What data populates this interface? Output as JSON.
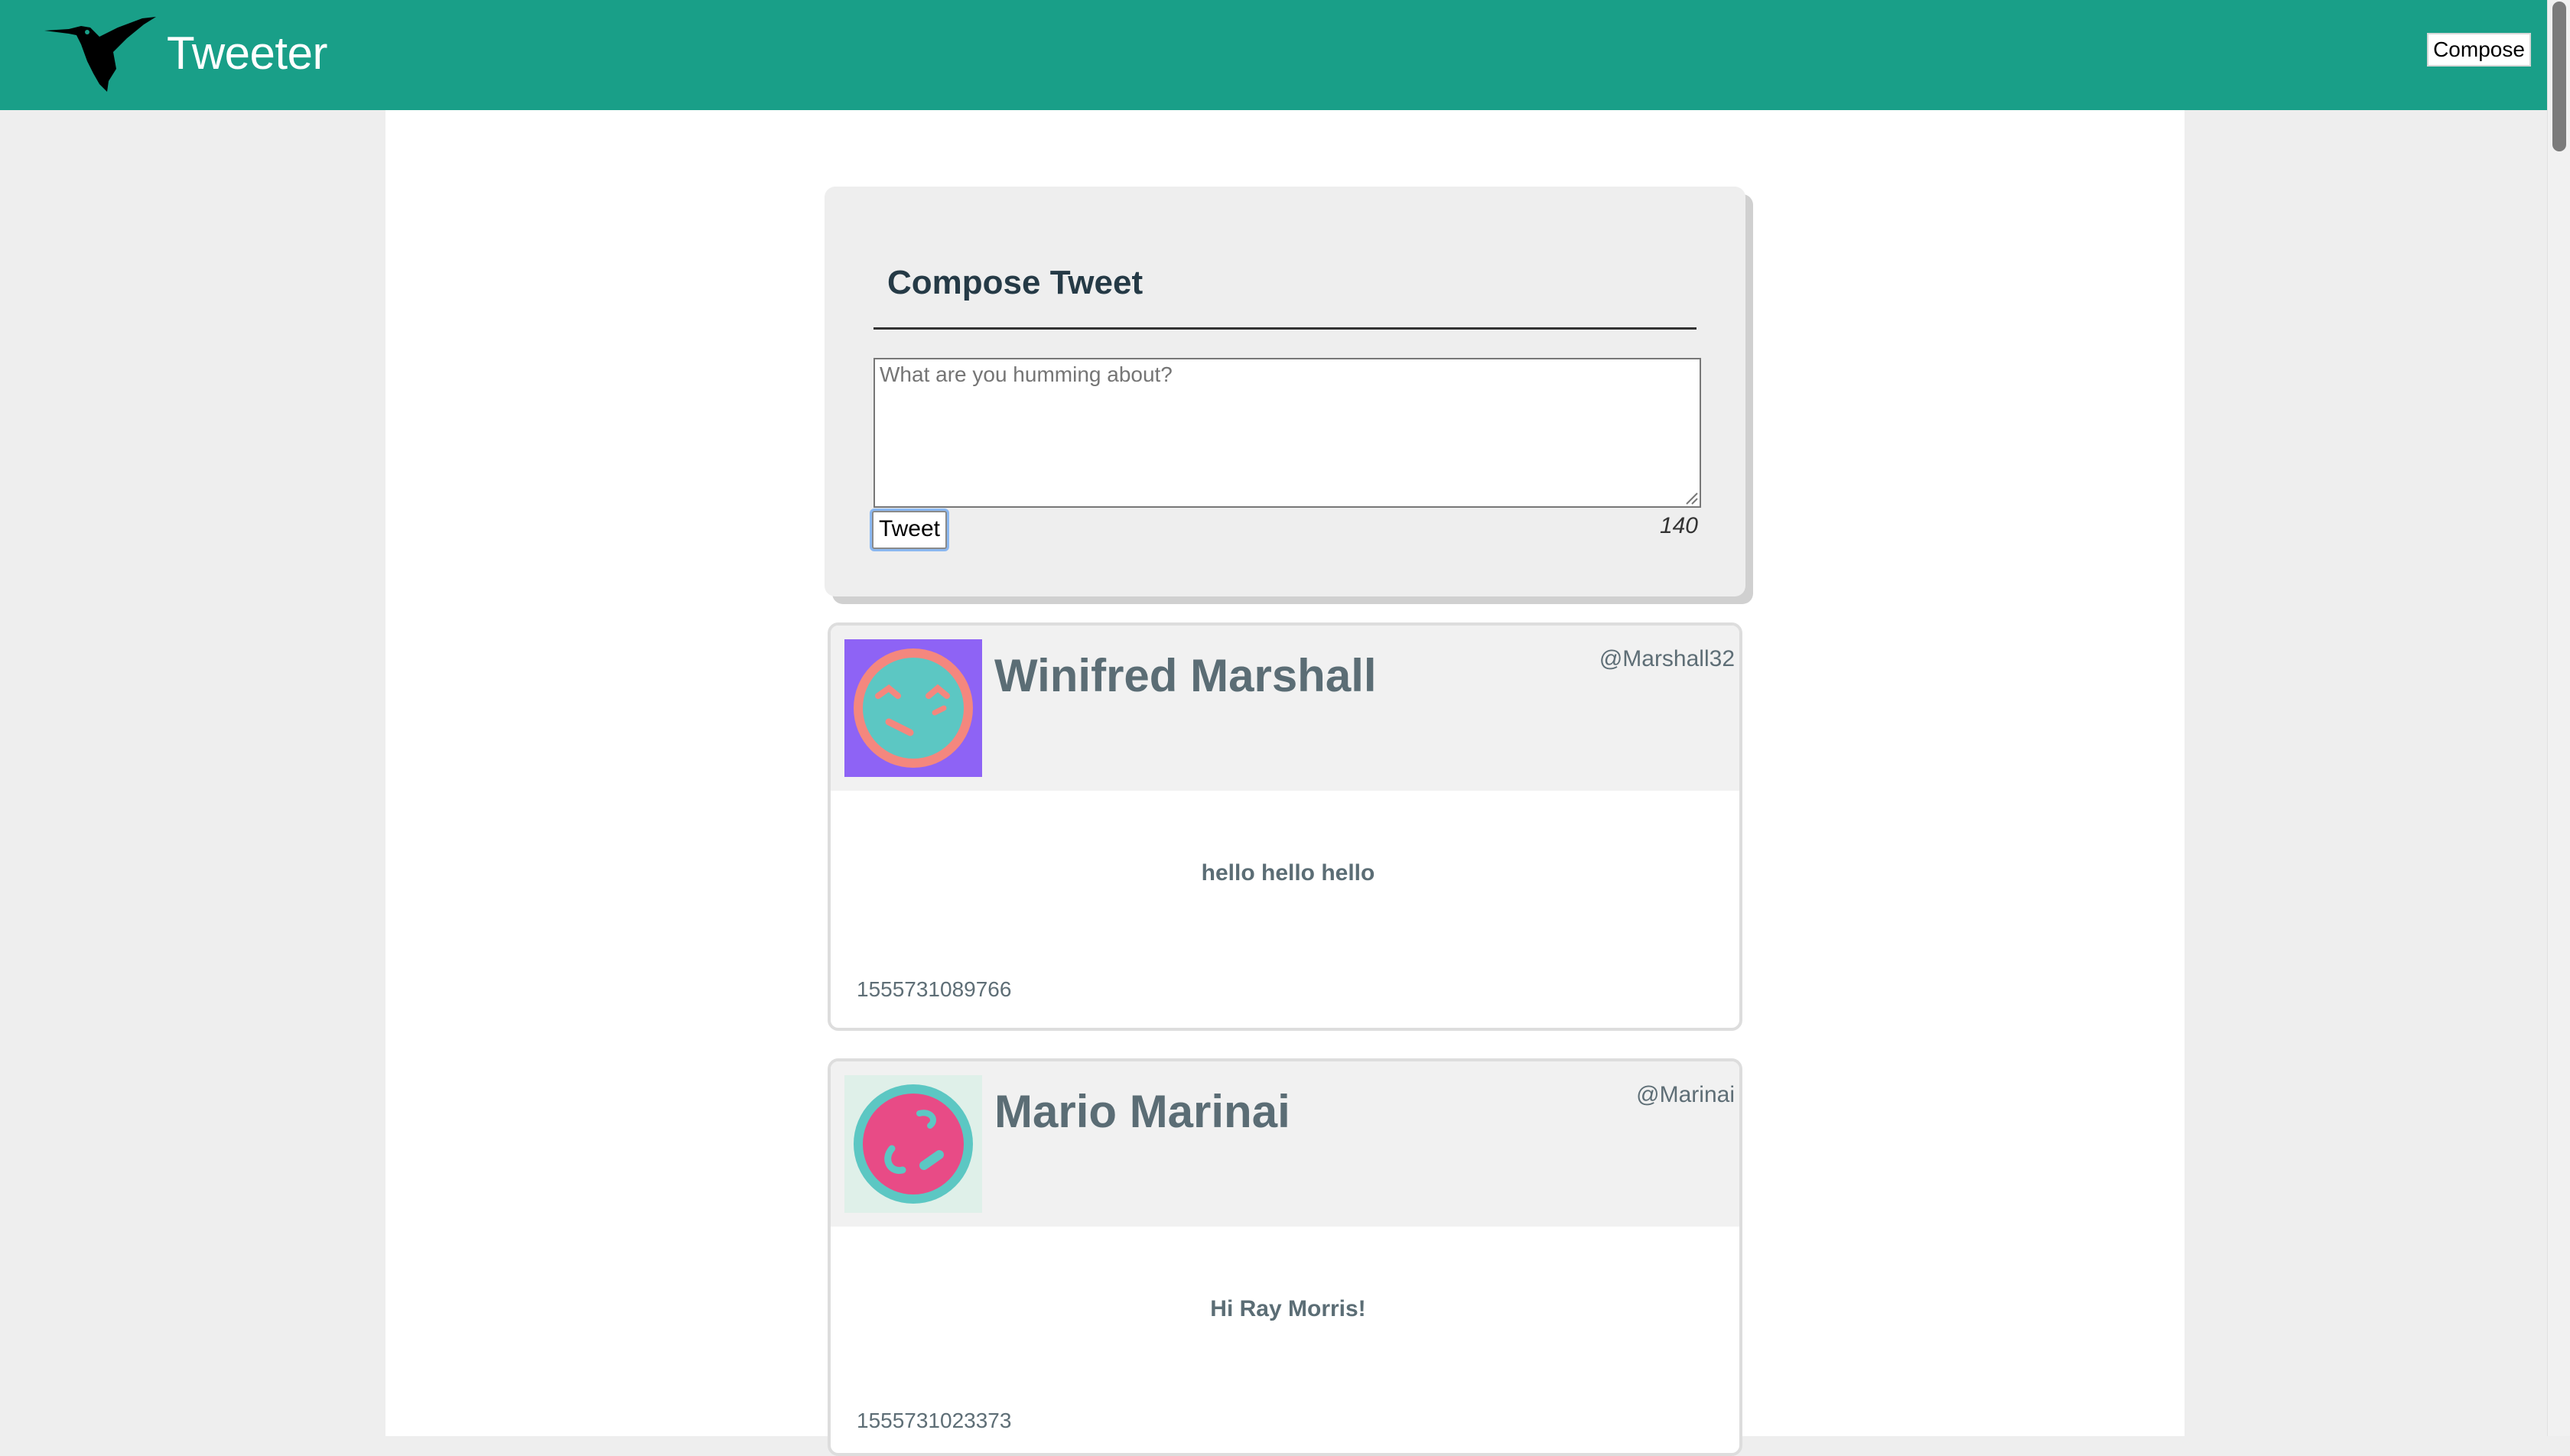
{
  "nav": {
    "brand": "Tweeter",
    "compose_label": "Compose",
    "logo_icon": "hummingbird-icon",
    "background_color": "#199f88"
  },
  "compose": {
    "title": "Compose Tweet",
    "placeholder": "What are you humming about?",
    "value": "",
    "submit_label": "Tweet",
    "counter": "140"
  },
  "tweets": [
    {
      "name": "Winifred Marshall",
      "handle": "@Marshall32",
      "text": "hello hello hello",
      "timestamp": "1555731089766",
      "avatar_icon": "avatar-face-icon",
      "avatar_colors": {
        "background": "#8e63f5",
        "ring": "#f4877e",
        "face": "#5cc7c3"
      }
    },
    {
      "name": "Mario Marinai",
      "handle": "@Marinai",
      "text": "Hi Ray Morris!",
      "timestamp": "1555731023373",
      "avatar_icon": "avatar-face-icon",
      "avatar_colors": {
        "background": "#dff0e9",
        "ring": "#5cc7c3",
        "face": "#e84b86"
      }
    }
  ]
}
